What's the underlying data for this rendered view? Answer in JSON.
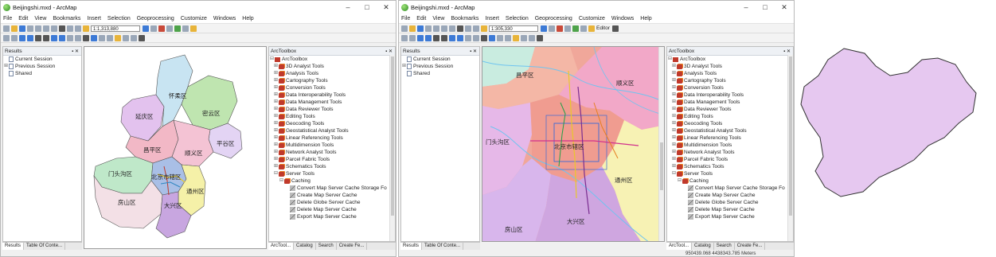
{
  "window1": {
    "title": "Beijingshi.mxd - ArcMap",
    "menu": [
      "File",
      "Edit",
      "View",
      "Bookmarks",
      "Insert",
      "Selection",
      "Geoprocessing",
      "Customize",
      "Windows",
      "Help"
    ],
    "scale": "1:1,313,880",
    "results_title": "Results",
    "results_items": [
      "Current Session",
      "Previous Session",
      "Shared"
    ],
    "toolbox_title": "ArcToolbox",
    "tabs_left": [
      "Results",
      "Table Of Conte..."
    ],
    "tabs_right": [
      "ArcTool...",
      "Catalog",
      "Search",
      "Create Fe..."
    ],
    "map_labels": [
      "怀柔区",
      "延庆区",
      "密云区",
      "平谷区",
      "昌平区",
      "顺义区",
      "门头沟区",
      "北京市辖区",
      "通州区",
      "房山区",
      "大兴区"
    ]
  },
  "window2": {
    "title": "Beijingshi.mxd - ArcMap",
    "menu": [
      "File",
      "Edit",
      "View",
      "Bookmarks",
      "Insert",
      "Selection",
      "Geoprocessing",
      "Customize",
      "Windows",
      "Help"
    ],
    "scale": "1:305,330",
    "editor_label": "Editor",
    "results_title": "Results",
    "results_items": [
      "Current Session",
      "Previous Session",
      "Shared"
    ],
    "toolbox_title": "ArcToolbox",
    "tabs_left": [
      "Results",
      "Table Of Conte..."
    ],
    "tabs_right": [
      "ArcTool...",
      "Catalog",
      "Search",
      "Create Fe..."
    ],
    "map_labels": [
      "昌平区",
      "顺义区",
      "门头沟区",
      "北京市辖区",
      "通州区",
      "房山区",
      "大兴区"
    ],
    "status": "950439.068   4438343.785 Meters"
  },
  "toolbox_items": [
    {
      "label": "3D Analyst Tools",
      "expanded": false
    },
    {
      "label": "Analysis Tools",
      "expanded": false
    },
    {
      "label": "Cartography Tools",
      "expanded": false
    },
    {
      "label": "Conversion Tools",
      "expanded": false
    },
    {
      "label": "Data Interoperability Tools",
      "expanded": false
    },
    {
      "label": "Data Management Tools",
      "expanded": false
    },
    {
      "label": "Data Reviewer Tools",
      "expanded": false
    },
    {
      "label": "Editing Tools",
      "expanded": false
    },
    {
      "label": "Geocoding Tools",
      "expanded": false
    },
    {
      "label": "Geostatistical Analyst Tools",
      "expanded": false
    },
    {
      "label": "Linear Referencing Tools",
      "expanded": false
    },
    {
      "label": "Multidimension Tools",
      "expanded": false
    },
    {
      "label": "Network Analyst Tools",
      "expanded": false
    },
    {
      "label": "Parcel Fabric Tools",
      "expanded": false
    },
    {
      "label": "Schematics Tools",
      "expanded": false
    },
    {
      "label": "Server Tools",
      "expanded": true
    }
  ],
  "server_children": {
    "group": "Caching",
    "tools": [
      "Convert Map Server Cache Storage Fo",
      "Create Map Server Cache",
      "Delete Globe Server Cache",
      "Delete Map Server Cache",
      "Export Map Server Cache"
    ]
  },
  "colors": {
    "district_pink": "#f2b8c6",
    "district_lavender": "#e3c2ee",
    "district_blue": "#a9bfe6",
    "district_green": "#bfe5b0",
    "district_yellow": "#f5f1a8",
    "district_purple": "#c8a6e0",
    "district_salmon": "#f4a89c",
    "shape_fill": "#e6c8f0"
  }
}
